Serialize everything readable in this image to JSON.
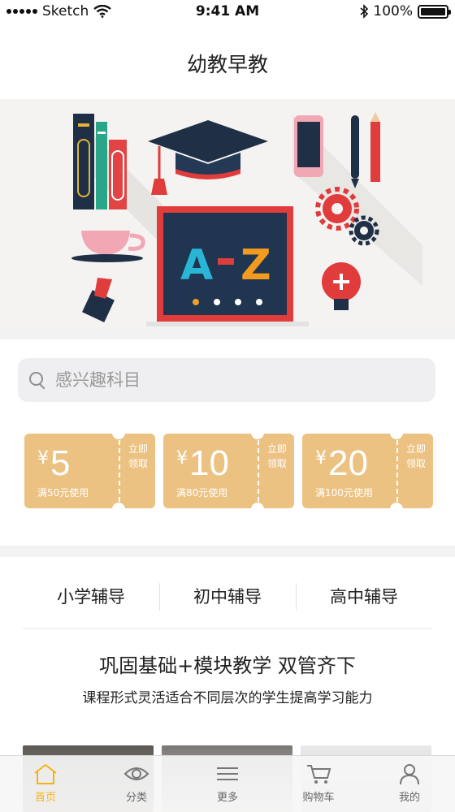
{
  "status_bar": {
    "carrier": "Sketch",
    "time": "9:41 AM",
    "battery": "100%",
    "icons": [
      "wifi-icon",
      "bluetooth-icon",
      "battery-icon"
    ]
  },
  "nav": {
    "title": "幼教早教"
  },
  "banner": {
    "text_left": "A",
    "text_right": "Z",
    "page_count": 4,
    "active_page": 1,
    "accent_colors": {
      "board": "#1e3550",
      "letter_a": "#29b6d6",
      "letter_z": "#f39b1e",
      "frame": "#e03c3c"
    }
  },
  "search": {
    "placeholder": "感兴趣科目"
  },
  "coupons": [
    {
      "symbol": "¥",
      "value": "5",
      "condition": "满50元使用",
      "action": "立即领取"
    },
    {
      "symbol": "¥",
      "value": "10",
      "condition": "满80元使用",
      "action": "立即领取"
    },
    {
      "symbol": "¥",
      "value": "20",
      "condition": "满100元使用",
      "action": "立即领取"
    }
  ],
  "coupon_color": "#ecc283",
  "tabs": [
    {
      "label": "小学辅导"
    },
    {
      "label": "初中辅导"
    },
    {
      "label": "高中辅导"
    }
  ],
  "slogan": {
    "title": "巩固基础+模块教学 双管齐下",
    "subtitle": "课程形式灵活适合不同层次的学生提高学习能力"
  },
  "tabbar": {
    "accent_color": "#f5b416",
    "items": [
      {
        "label": "首页",
        "icon": "home-icon",
        "active": true
      },
      {
        "label": "分类",
        "icon": "eye-icon",
        "active": false
      },
      {
        "label": "更多",
        "icon": "menu-icon",
        "active": false
      },
      {
        "label": "购物车",
        "icon": "cart-icon",
        "active": false
      },
      {
        "label": "我的",
        "icon": "user-icon",
        "active": false
      }
    ]
  }
}
